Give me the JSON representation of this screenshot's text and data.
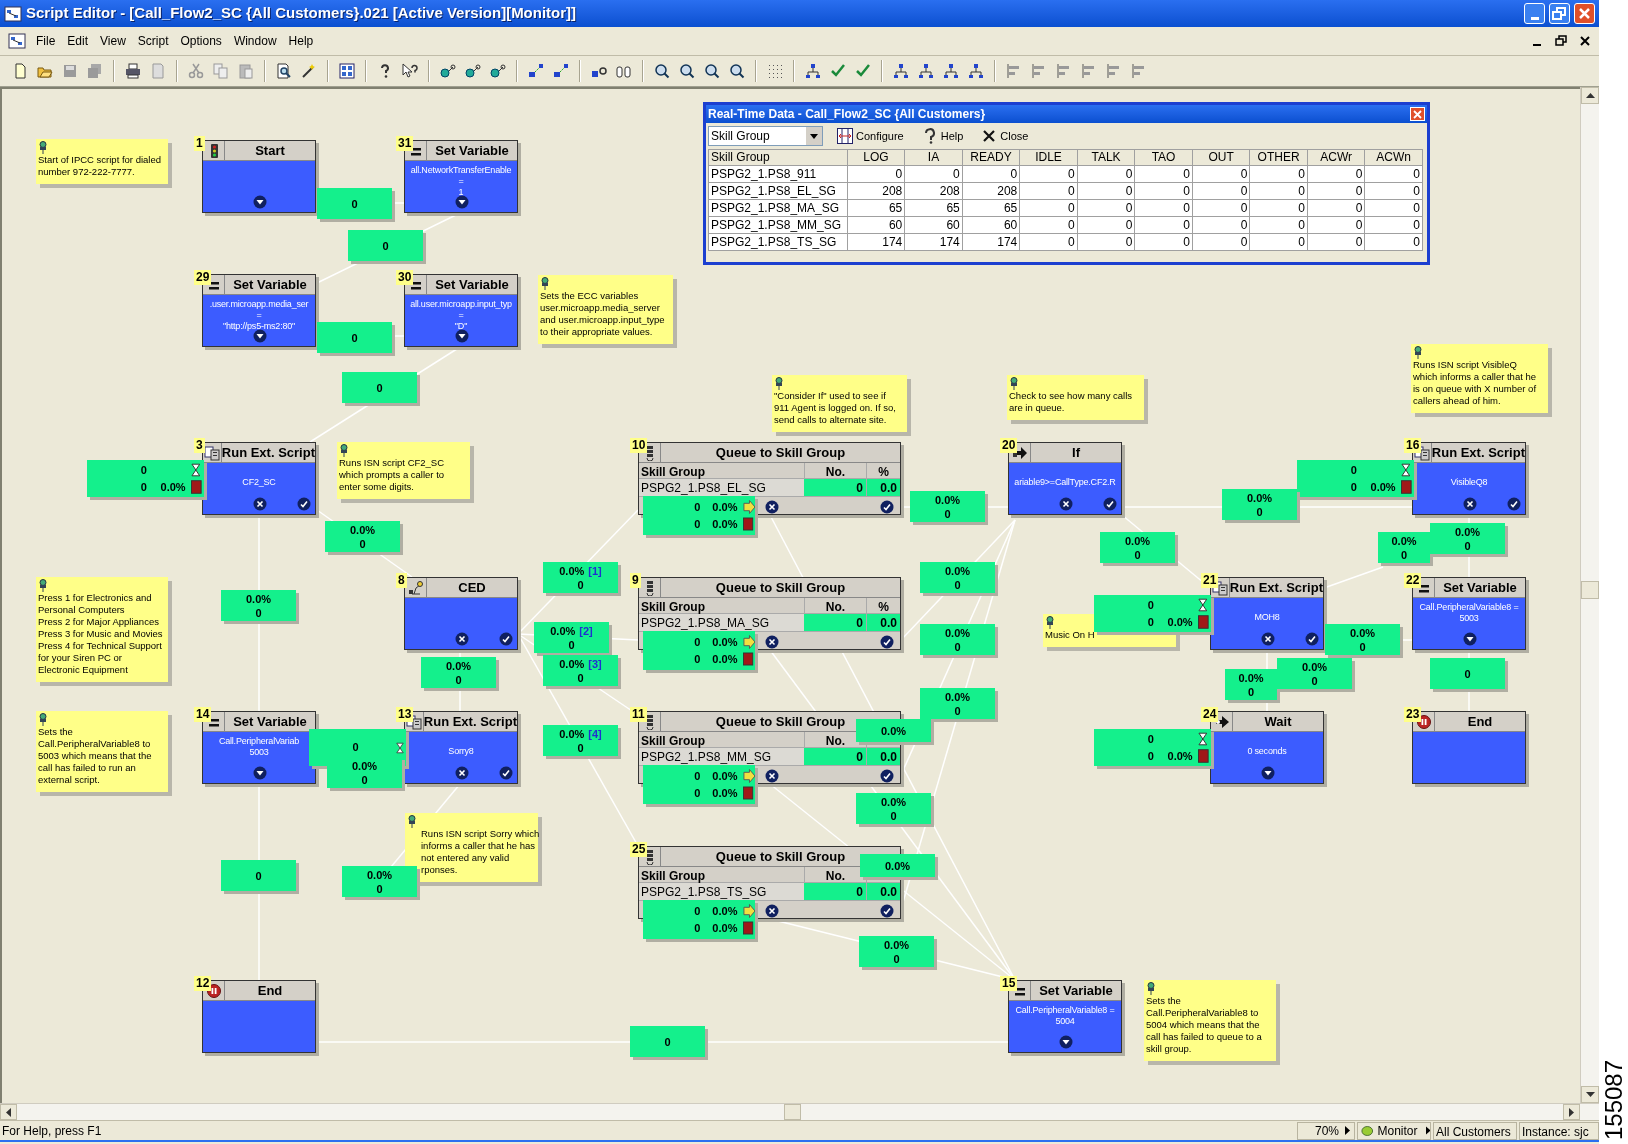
{
  "window": {
    "title": "Script Editor - [Call_Flow2_SC {All Customers}.021 [Active Version][Monitor]]"
  },
  "menu": [
    "File",
    "Edit",
    "View",
    "Script",
    "Options",
    "Window",
    "Help"
  ],
  "realtime_panel": {
    "title": "Real-Time Data - Call_Flow2_SC {All Customers}",
    "dropdown": "Skill Group",
    "buttons": [
      {
        "kind": "configure",
        "label": "Configure"
      },
      {
        "kind": "help",
        "label": "Help"
      },
      {
        "kind": "close",
        "label": "Close"
      }
    ],
    "columns": [
      "Skill Group",
      "LOG",
      "IA",
      "READY",
      "IDLE",
      "TALK",
      "TAO",
      "OUT",
      "OTHER",
      "ACWr",
      "ACWn"
    ],
    "rows": [
      [
        "PSPG2_1.PS8_911",
        "0",
        "0",
        "0",
        "0",
        "0",
        "0",
        "0",
        "0",
        "0",
        "0"
      ],
      [
        "PSPG2_1.PS8_EL_SG",
        "208",
        "208",
        "208",
        "0",
        "0",
        "0",
        "0",
        "0",
        "0",
        "0"
      ],
      [
        "PSPG2_1.PS8_MA_SG",
        "65",
        "65",
        "65",
        "0",
        "0",
        "0",
        "0",
        "0",
        "0",
        "0"
      ],
      [
        "PSPG2_1.PS8_MM_SG",
        "60",
        "60",
        "60",
        "0",
        "0",
        "0",
        "0",
        "0",
        "0",
        "0"
      ],
      [
        "PSPG2_1.PS8_TS_SG",
        "174",
        "174",
        "174",
        "0",
        "0",
        "0",
        "0",
        "0",
        "0",
        "0"
      ]
    ]
  },
  "notes": [
    {
      "lines": [
        "Start of IPCC script for dialed",
        "number 972-222-7777."
      ]
    },
    {
      "lines": [
        "Sets the ECC variables",
        "user.microapp.media_server",
        "and user.microapp.input_type",
        "to their appropriate values."
      ]
    },
    {
      "lines": [
        "Runs ISN script VisibleQ",
        "which informs a caller that he",
        "is on queue with X number of",
        "callers ahead of him."
      ]
    },
    {
      "lines": [
        "\"Consider If\" used to see if",
        "911 Agent is logged on.  If so,",
        "send calls to alternate site."
      ]
    },
    {
      "lines": [
        "Check to see how many calls",
        "are in queue."
      ]
    },
    {
      "lines": [
        "Runs ISN script CF2_SC",
        "which prompts a caller to",
        "enter some digits."
      ]
    },
    {
      "lines": [
        "Press 1 for Electronics and",
        "Personal Computers",
        "Press 2 for Major Appliances",
        "Press 3 for Music and Movies",
        "Press 4 for Technical Support",
        "for your Siren PC or",
        "Electronic Equipment"
      ]
    },
    {
      "lines": [
        "Music On H"
      ]
    },
    {
      "lines": [
        "Sets the",
        "Call.PeripheralVariable8 to",
        "5003 which means that the",
        "call has failed to run an",
        "external script."
      ]
    },
    {
      "lines": [
        "Runs ISN script Sorry which",
        "informs a caller that he has",
        "not entered any valid",
        "rponses."
      ]
    },
    {
      "lines": [
        "Sets the",
        "Call.PeripheralVariable8 to",
        "5004 which means that the",
        "call has failed to queue to a",
        "skill group."
      ]
    }
  ],
  "nodes": [
    {
      "number": "1",
      "kind": "start",
      "title": "Start"
    },
    {
      "number": "31",
      "kind": "set_variable",
      "title": "Set Variable",
      "lines": [
        "all.NetworkTransferEnable",
        "=",
        "1"
      ]
    },
    {
      "number": "29",
      "kind": "set_variable",
      "title": "Set Variable",
      "lines": [
        ".user.microapp.media_ser",
        "=",
        "\"http://ps5-ms2:80\""
      ]
    },
    {
      "number": "30",
      "kind": "set_variable",
      "title": "Set Variable",
      "lines": [
        "all.user.microapp.input_typ",
        "=",
        "\"D\""
      ]
    },
    {
      "number": "3",
      "kind": "run_ext_script",
      "title": "Run Ext. Script",
      "lines": [
        "CF2_SC"
      ],
      "counter": {
        "waiting": "0",
        "count": "0",
        "percent": "0.0%"
      }
    },
    {
      "number": "10",
      "kind": "queue",
      "title": "Queue to Skill Group",
      "columns": [
        "Skill Group",
        "No.",
        "%"
      ],
      "skill_group": "PSPG2_1.PS8_EL_SG",
      "no": "0",
      "pct": "0.0",
      "counters": [
        {
          "count": "0",
          "percent": "0.0%"
        },
        {
          "count": "0",
          "percent": "0.0%"
        }
      ]
    },
    {
      "number": "20",
      "kind": "if",
      "title": "If",
      "lines": [
        "ariable9>=CallType.CF2.R"
      ]
    },
    {
      "number": "16",
      "kind": "run_ext_script",
      "title": "Run Ext. Script",
      "lines": [
        "VisibleQ8"
      ],
      "counter": {
        "waiting": "0",
        "count": "0",
        "percent": "0.0%"
      }
    },
    {
      "number": "8",
      "kind": "ced",
      "title": "CED"
    },
    {
      "number": "9",
      "kind": "queue",
      "title": "Queue to Skill Group",
      "columns": [
        "Skill Group",
        "No.",
        "%"
      ],
      "skill_group": "PSPG2_1.PS8_MA_SG",
      "no": "0",
      "pct": "0.0",
      "counters": [
        {
          "count": "0",
          "percent": "0.0%"
        },
        {
          "count": "0",
          "percent": "0.0%"
        }
      ]
    },
    {
      "number": "21",
      "kind": "run_ext_script",
      "title": "Run Ext. Script",
      "lines": [
        "MOH8"
      ],
      "counter": {
        "waiting": "0",
        "count": "0",
        "percent": "0.0%"
      }
    },
    {
      "number": "22",
      "kind": "set_variable",
      "title": "Set Variable",
      "lines": [
        "Call.PeripheralVariable8 =",
        "5003"
      ]
    },
    {
      "number": "14",
      "kind": "set_variable",
      "title": "Set Variable",
      "lines": [
        "Call.PeripheralVariab",
        "5003"
      ]
    },
    {
      "number": "13",
      "kind": "run_ext_script",
      "title": "Run Ext. Script",
      "lines": [
        "Sorry8"
      ],
      "counter": {
        "waiting": "0"
      }
    },
    {
      "number": "11",
      "kind": "queue",
      "title": "Queue to Skill Group",
      "columns": [
        "Skill Group",
        "No."
      ],
      "skill_group": "PSPG2_1.PS8_MM_SG",
      "no": "0",
      "pct": "0.0",
      "counters": [
        {
          "count": "0",
          "percent": "0.0%"
        },
        {
          "count": "0",
          "percent": "0.0%"
        }
      ]
    },
    {
      "number": "24",
      "kind": "wait",
      "title": "Wait",
      "lines": [
        "0 seconds"
      ],
      "counter": {
        "waiting": "0",
        "count": "0",
        "percent": "0.0%"
      }
    },
    {
      "number": "23",
      "kind": "end",
      "title": "End"
    },
    {
      "number": "25",
      "kind": "queue",
      "title": "Queue to Skill Group",
      "columns": [
        "Skill Group",
        "No."
      ],
      "skill_group": "PSPG2_1.PS8_TS_SG",
      "no": "0",
      "pct": "0.0",
      "counters": [
        {
          "count": "0",
          "percent": "0.0%"
        },
        {
          "count": "0",
          "percent": "0.0%"
        }
      ]
    },
    {
      "number": "12",
      "kind": "end",
      "title": "End"
    },
    {
      "number": "15",
      "kind": "set_variable",
      "title": "Set Variable",
      "lines": [
        "Call.PeripheralVariable8 =",
        "5004"
      ]
    }
  ],
  "flow_counts": [
    {
      "lines": [
        "0"
      ]
    },
    {
      "lines": [
        "0"
      ]
    },
    {
      "lines": [
        "0"
      ]
    },
    {
      "lines": [
        "0"
      ]
    },
    {
      "lines": [
        "0.0%",
        "0"
      ]
    },
    {
      "lines": [
        "0.0%",
        "0"
      ]
    },
    {
      "lines": [
        "0.0%",
        "0"
      ]
    },
    {
      "lines": [
        "0.0%",
        "0"
      ]
    },
    {
      "lines": [
        "0.0%",
        "0"
      ]
    },
    {
      "lines": [
        "0.0%",
        "0"
      ]
    },
    {
      "lines": [
        "0.0%",
        "0"
      ],
      "branch": "[1]"
    },
    {
      "lines": [
        "0.0%",
        "0"
      ]
    },
    {
      "lines": [
        "0.0%",
        "0"
      ]
    },
    {
      "lines": [
        "0.0%",
        "0"
      ],
      "branch": "[2]"
    },
    {
      "lines": [
        "0.0%",
        "0"
      ],
      "branch": "[3]"
    },
    {
      "lines": [
        "0.0%",
        "0"
      ]
    },
    {
      "lines": [
        "0.0%",
        "0"
      ]
    },
    {
      "lines": [
        "0.0%",
        "0"
      ]
    },
    {
      "lines": [
        "0.0%",
        "0"
      ]
    },
    {
      "lines": [
        "0.0%",
        "0"
      ]
    },
    {
      "lines": [
        "0"
      ]
    },
    {
      "lines": [
        "0.0%",
        "0"
      ]
    },
    {
      "lines": [
        "0.0%",
        "0"
      ],
      "branch": "[4]"
    },
    {
      "lines": [
        "0.0%"
      ]
    },
    {
      "lines": [
        "0.0%",
        "0"
      ]
    },
    {
      "lines": [
        "0.0%",
        "0"
      ]
    },
    {
      "lines": [
        "0"
      ]
    },
    {
      "lines": [
        "0.0%",
        "0"
      ]
    },
    {
      "lines": [
        "0.0%"
      ]
    },
    {
      "lines": [
        "0.0%",
        "0"
      ]
    },
    {
      "lines": [
        "0"
      ]
    }
  ],
  "status_bar": {
    "help": "For Help, press F1",
    "zoom": "70%",
    "mode": "Monitor",
    "customer": "All Customers",
    "instance": "Instance: sjc"
  },
  "figure_id": "155087"
}
